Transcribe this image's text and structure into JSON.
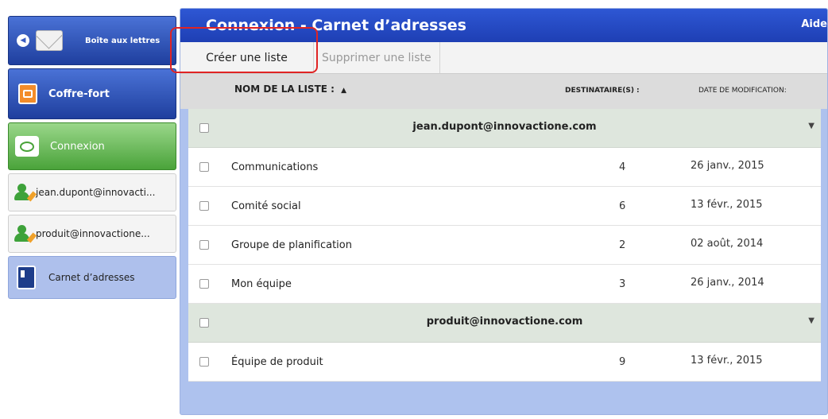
{
  "sidebar": {
    "mailbox_label": "Boîte aux lettres",
    "vault_label": "Coffre-fort",
    "connection_label": "Connexion",
    "accounts": [
      {
        "label": "jean.dupont@innovacti..."
      },
      {
        "label": "produit@innovactione..."
      }
    ],
    "address_book_label": "Carnet d’adresses"
  },
  "header": {
    "title": "Connexion - Carnet d’adresses",
    "help": "Aide"
  },
  "toolbar": {
    "create_label": "Créer une liste",
    "delete_label": "Supprimer une liste"
  },
  "columns": {
    "name": "NOM DE LA LISTE :",
    "sort_indicator": "▲",
    "recipients": "DESTINATAIRE(S) :",
    "modified": "DATE DE MODIFICATION:"
  },
  "groups": [
    {
      "account": "jean.dupont@innovactione.com",
      "lists": [
        {
          "name": "Communications",
          "count": "4",
          "date": "26 janv., 2015"
        },
        {
          "name": "Comité social",
          "count": "6",
          "date": "13 févr., 2015"
        },
        {
          "name": "Groupe de planification",
          "count": "2",
          "date": "02 août, 2014"
        },
        {
          "name": "Mon équipe",
          "count": "3",
          "date": "26 janv., 2014"
        }
      ]
    },
    {
      "account": "produit@innovactione.com",
      "lists": [
        {
          "name": "Équipe de produit",
          "count": "9",
          "date": "13 févr., 2015"
        }
      ]
    }
  ],
  "colors": {
    "title_blue": "#1e3fb4",
    "group_row": "#dee6dd",
    "highlight": "#e02424",
    "selected_sidebar": "#aec0ec"
  }
}
